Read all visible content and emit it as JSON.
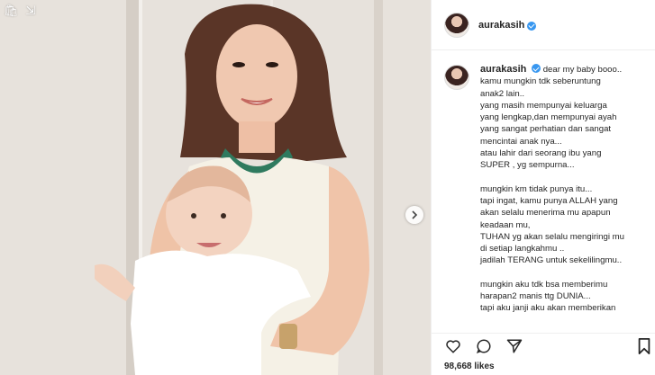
{
  "post": {
    "username": "aurakasih",
    "verified": true,
    "likes": "98,668 likes"
  },
  "media": {
    "icons": [
      "cart-icon",
      "collapse-arrows-icon"
    ],
    "next_icon": "chevron-right-icon"
  },
  "caption": {
    "username": "aurakasih",
    "first_line": "dear my baby booo..",
    "lines": [
      "kamu mungkin tdk seberuntung",
      "anak2 lain..",
      "yang masih mempunyai keluarga",
      "yang lengkap,dan mempunyai ayah",
      "yang sangat perhatian dan sangat",
      "mencintai anak nya...",
      "atau lahir dari seorang ibu yang",
      "SUPER , yg sempurna...",
      "",
      "mungkin km tidak punya itu...",
      "tapi ingat, kamu punya ALLAH yang",
      "akan selalu menerima mu apapun",
      "keadaan mu,",
      "TUHAN yg akan selalu mengiringi mu",
      "di setiap langkahmu ..",
      "jadilah TERANG untuk sekelilingmu..",
      "",
      "mungkin aku tdk bsa memberimu",
      "harapan2 manis ttg DUNIA...",
      "tapi aku janji aku akan memberikan"
    ]
  },
  "actions": [
    "heart-icon",
    "comment-icon",
    "share-icon",
    "bookmark-icon"
  ],
  "colors": {
    "verified": "#3897f0",
    "text": "#262626",
    "border": "#efefef"
  }
}
